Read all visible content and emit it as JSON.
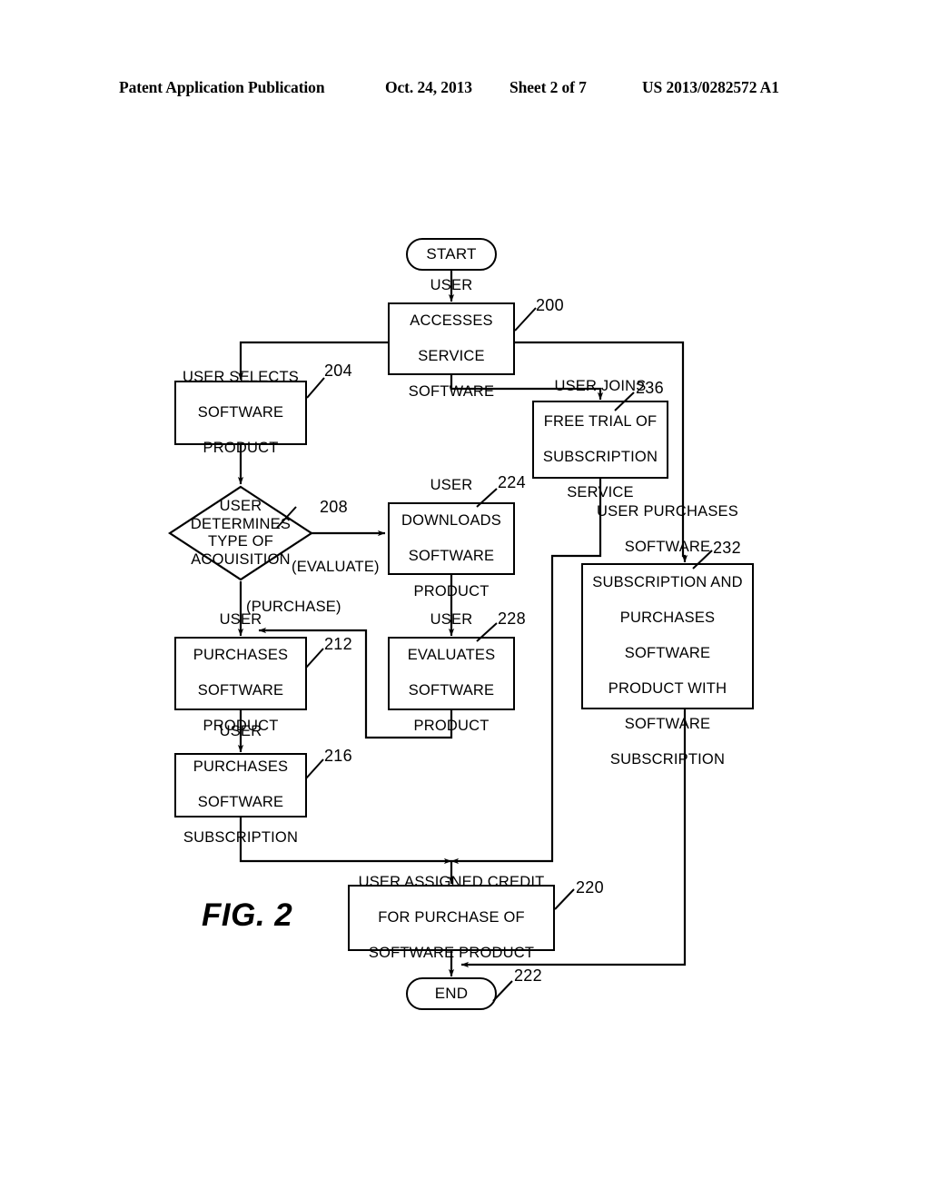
{
  "header": {
    "publication": "Patent Application Publication",
    "date": "Oct. 24, 2013",
    "sheet": "Sheet 2 of 7",
    "patent_number": "US 2013/0282572 A1"
  },
  "figure": {
    "label": "FIG. 2"
  },
  "nodes": {
    "start": {
      "label": "START",
      "shape": "terminal"
    },
    "n200": {
      "label": "USER ACCESSES SERVICE SOFTWARE",
      "ref": "200",
      "shape": "process"
    },
    "n204": {
      "label": "USER SELECTS SOFTWARE PRODUCT",
      "ref": "204",
      "shape": "process"
    },
    "n236": {
      "label": "USER JOINS FREE TRIAL OF SUBSCRIPTION SERVICE",
      "ref": "236",
      "shape": "process"
    },
    "n208": {
      "label": "USER DETERMINES TYPE OF ACQUISITION",
      "ref": "208",
      "shape": "decision"
    },
    "n224": {
      "label": "USER DOWNLOADS SOFTWARE PRODUCT",
      "ref": "224",
      "shape": "process"
    },
    "n232": {
      "label": "USER PURCHASES SOFTWARE SUBSCRIPTION AND PURCHASES SOFTWARE PRODUCT WITH SOFTWARE SUBSCRIPTION",
      "ref": "232",
      "shape": "process"
    },
    "n212": {
      "label": "USER PURCHASES SOFTWARE PRODUCT",
      "ref": "212",
      "shape": "process"
    },
    "n228": {
      "label": "USER EVALUATES SOFTWARE PRODUCT",
      "ref": "228",
      "shape": "process"
    },
    "n216": {
      "label": "USER PURCHASES SOFTWARE SUBSCRIPTION",
      "ref": "216",
      "shape": "process"
    },
    "n220": {
      "label": "USER ASSIGNED CREDIT FOR PURCHASE OF SOFTWARE PRODUCT",
      "ref": "220",
      "shape": "process"
    },
    "end": {
      "label": "END",
      "ref": "222",
      "shape": "terminal"
    }
  },
  "branch_labels": {
    "evaluate": "(EVALUATE)",
    "purchase": "(PURCHASE)"
  },
  "node_lines": {
    "n200": [
      "USER",
      "ACCESSES",
      "SERVICE",
      "SOFTWARE"
    ],
    "n204": [
      "USER SELECTS",
      "SOFTWARE",
      "PRODUCT"
    ],
    "n236": [
      "USER JOINS",
      "FREE TRIAL OF",
      "SUBSCRIPTION",
      "SERVICE"
    ],
    "n208": [
      "USER",
      "DETERMINES",
      "TYPE OF",
      "ACQUISITION"
    ],
    "n224": [
      "USER",
      "DOWNLOADS",
      "SOFTWARE",
      "PRODUCT"
    ],
    "n232": [
      "USER PURCHASES",
      "SOFTWARE",
      "SUBSCRIPTION AND",
      "PURCHASES",
      "SOFTWARE",
      "PRODUCT WITH",
      "SOFTWARE",
      "SUBSCRIPTION"
    ],
    "n212": [
      "USER",
      "PURCHASES",
      "SOFTWARE",
      "PRODUCT"
    ],
    "n228": [
      "USER",
      "EVALUATES",
      "SOFTWARE",
      "PRODUCT"
    ],
    "n216": [
      "USER",
      "PURCHASES",
      "SOFTWARE",
      "SUBSCRIPTION"
    ],
    "n220": [
      "USER ASSIGNED CREDIT",
      "FOR PURCHASE OF",
      "SOFTWARE PRODUCT"
    ]
  },
  "colors": {
    "ink": "#000000",
    "paper": "#ffffff"
  }
}
